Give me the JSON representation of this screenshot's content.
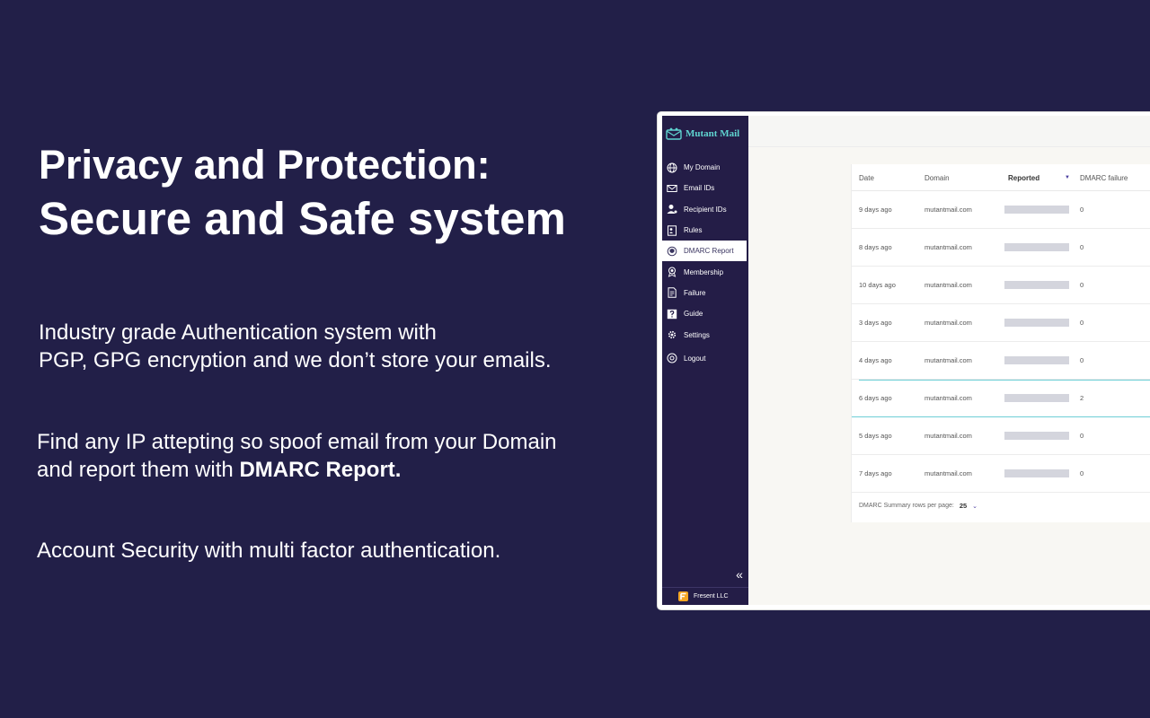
{
  "headline": {
    "line1": "Privacy and Protection:",
    "line2": "Secure and Safe system"
  },
  "paragraphs": {
    "auth_line1": "Industry grade Authentication system with",
    "auth_line2": "PGP, GPG encryption and we don’t store your emails.",
    "dmarc_line1": "Find any IP attepting so spoof email from your Domain",
    "dmarc_line2_prefix": "and report them with ",
    "dmarc_line2_bold": "DMARC Report.",
    "mfa": "Account Security with multi factor authentication."
  },
  "app": {
    "brand": "Mutant Mail",
    "nav": [
      {
        "label": "My Domain",
        "icon": "globe-icon"
      },
      {
        "label": "Email IDs",
        "icon": "envelope-icon"
      },
      {
        "label": "Recipient IDs",
        "icon": "user-icon"
      },
      {
        "label": "Rules",
        "icon": "rules-icon"
      },
      {
        "label": "DMARC Report",
        "icon": "shield-icon",
        "active": true
      },
      {
        "label": "Membership",
        "icon": "badge-icon"
      },
      {
        "label": "Failure",
        "icon": "document-icon"
      },
      {
        "label": "Guide",
        "icon": "question-icon"
      },
      {
        "label": "Settings",
        "icon": "gear-icon"
      },
      {
        "label": "Logout",
        "icon": "power-icon"
      }
    ],
    "collapse_glyph": "«",
    "footer_company": "Fresent LLC",
    "table": {
      "headers": {
        "date": "Date",
        "domain": "Domain",
        "reported": "Reported",
        "failure": "DMARC failure"
      },
      "rows": [
        {
          "date": "9 days ago",
          "domain": "mutantmail.com",
          "failure": "0"
        },
        {
          "date": "8 days ago",
          "domain": "mutantmail.com",
          "failure": "0"
        },
        {
          "date": "10 days ago",
          "domain": "mutantmail.com",
          "failure": "0"
        },
        {
          "date": "3 days ago",
          "domain": "mutantmail.com",
          "failure": "0"
        },
        {
          "date": "4 days ago",
          "domain": "mutantmail.com",
          "failure": "0"
        },
        {
          "date": "6 days ago",
          "domain": "mutantmail.com",
          "failure": "2"
        },
        {
          "date": "5 days ago",
          "domain": "mutantmail.com",
          "failure": "0"
        },
        {
          "date": "7 days ago",
          "domain": "mutantmail.com",
          "failure": "0"
        }
      ],
      "pager_label": "DMARC Summary rows per page:",
      "rows_per_page": "25"
    }
  },
  "colors": {
    "background": "#221f48",
    "sidebar": "#241d47",
    "brand_text": "#5fd4d0",
    "accent": "#4b3fa0",
    "highlight": "#6ecfd6"
  }
}
